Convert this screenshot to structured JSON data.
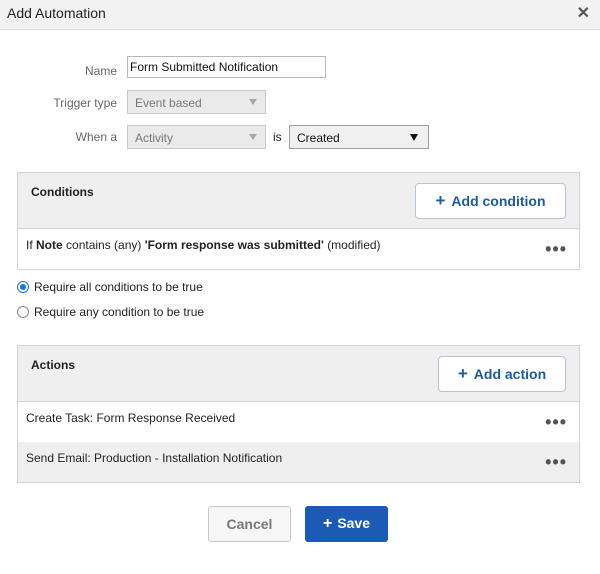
{
  "dialog": {
    "title": "Add Automation",
    "close_icon": "close-icon"
  },
  "form": {
    "name_label": "Name",
    "name_value": "Form Submitted Notification",
    "trigger_label": "Trigger type",
    "trigger_value": "Event based",
    "when_label": "When a",
    "when_value": "Activity",
    "is_label": "is",
    "is_value": "Created"
  },
  "conditions": {
    "title": "Conditions",
    "add_label": "Add condition",
    "items": [
      {
        "prefix": "If",
        "field": "Note",
        "op": "contains (any)",
        "value": "'Form response was submitted'",
        "suffix": "(modified)"
      }
    ]
  },
  "match": {
    "all_label": "Require all conditions to be true",
    "any_label": "Require any condition to be true",
    "selected": "all"
  },
  "actions": {
    "title": "Actions",
    "add_label": "Add action",
    "items": [
      {
        "label": "Create Task: Form Response Received"
      },
      {
        "label": "Send Email: Production - Installation Notification"
      }
    ]
  },
  "footer": {
    "cancel_label": "Cancel",
    "save_label": "Save"
  },
  "colors": {
    "accent": "#1b5bb5",
    "link": "#1d5aa3",
    "panel_head": "#efefef"
  }
}
